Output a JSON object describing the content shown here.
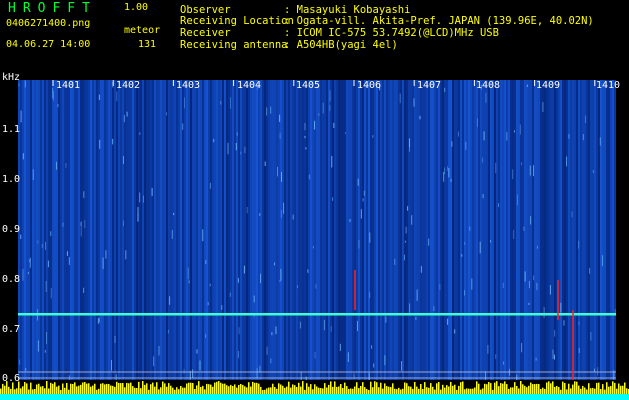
{
  "header": {
    "app_title": "HROFFT",
    "app_version": "1.00",
    "file_name": "0406271400.png",
    "mode_label": "meteor",
    "date_time": "04.06.27 14:00",
    "meteor_count": "131",
    "fields": [
      {
        "key": "Observer",
        "value": ": Masayuki Kobayashi"
      },
      {
        "key": "Receiving Location",
        "value": ": Ogata-vill. Akita-Pref. JAPAN (139.96E, 40.02N)"
      },
      {
        "key": "Receiver",
        "value": ": ICOM IC-575 53.7492(@LCD)MHz USB"
      },
      {
        "key": "Receiving antenna",
        "value": ": A504HB(yagi 4el)"
      }
    ]
  },
  "chart_data": {
    "type": "heatmap",
    "ylabel": "kHz",
    "x_ticks": [
      "1401",
      "1402",
      "1403",
      "1404",
      "1405",
      "1406",
      "1407",
      "1408",
      "1409",
      "1410"
    ],
    "y_ticks": [
      "1.1",
      "1.0",
      "0.9",
      "0.8",
      "0.7",
      "0.6"
    ],
    "carrier_line_khz": 0.73,
    "colors": {
      "background": "#001a66",
      "noise": "#1e6cff",
      "carrier": "#40ffd0",
      "marker": "#ff2020",
      "bars": "#ffff00",
      "strip": "#00ffff"
    }
  }
}
